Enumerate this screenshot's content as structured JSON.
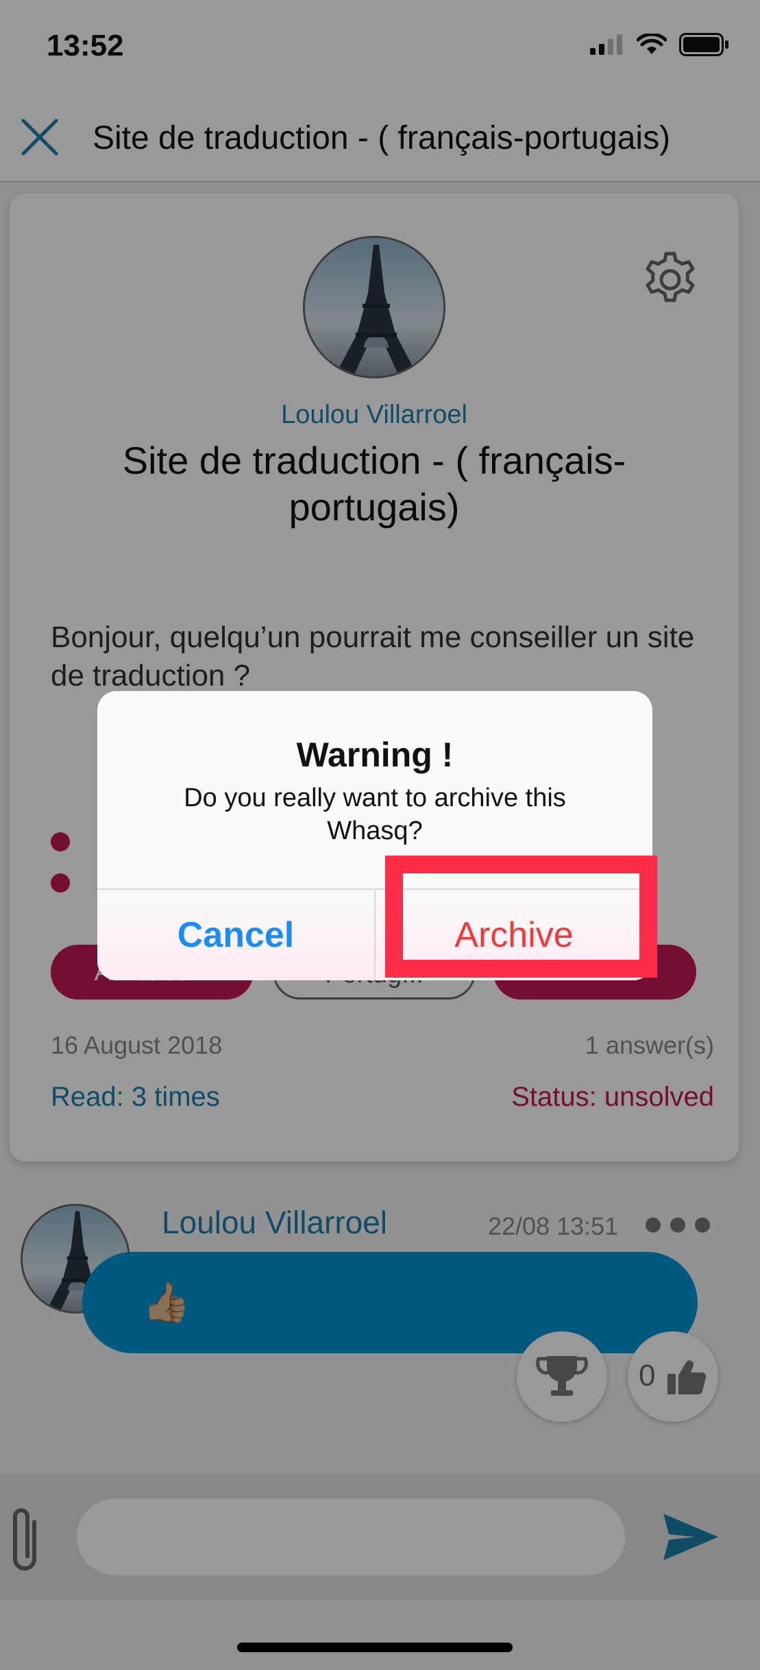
{
  "status_bar": {
    "time": "13:52"
  },
  "nav": {
    "title": "Site de traduction  - ( français-portugais)"
  },
  "question": {
    "author": "Loulou Villarroel",
    "title": "Site de traduction  - ( français-portugais)",
    "body": "Bonjour, quelqu’un pourrait me conseiller un site de traduction ?",
    "tags": [
      "Ambass...",
      "Portug...",
      ""
    ],
    "date": "16 August 2018",
    "answers": "1 answer(s)",
    "read": "Read: 3 times",
    "status": "Status: unsolved"
  },
  "answer": {
    "author": "Loulou Villarroel",
    "time": "22/08 13:51",
    "content": "👍🏼",
    "like_count": "0"
  },
  "dialog": {
    "title": "Warning !",
    "message": "Do you really want to archive this Whasq?",
    "cancel_label": "Cancel",
    "archive_label": "Archive"
  },
  "colors": {
    "accent_blue": "#1a7fa8",
    "magenta": "#c2185b",
    "bubble": "#0096d6",
    "ios_blue": "#1a8cf5",
    "destructive_red": "#ef3a3a",
    "highlight": "#ff2d48"
  }
}
